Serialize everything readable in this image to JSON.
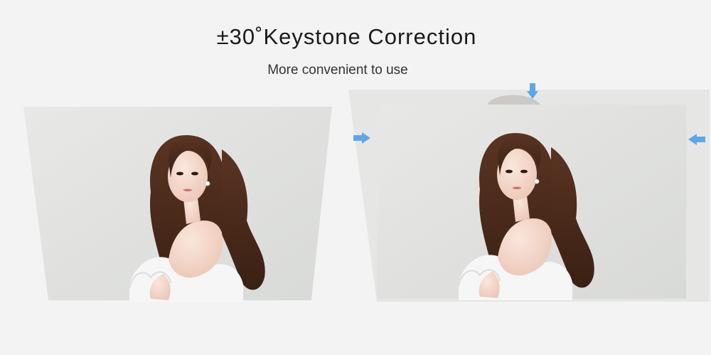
{
  "header": {
    "title": "±30˚Keystone Correction",
    "subtitle": "More convenient to use"
  },
  "left_panel": {
    "caption": ""
  },
  "right_panel": {
    "caption": ""
  },
  "colors": {
    "background": "#f3f3f3",
    "arrow": "#5aa9e6",
    "hair": "#4a2a1a",
    "dress": "#f4f4f4"
  },
  "icons": [
    "arrow-right-icon",
    "arrow-down-icon",
    "arrow-left-icon"
  ]
}
